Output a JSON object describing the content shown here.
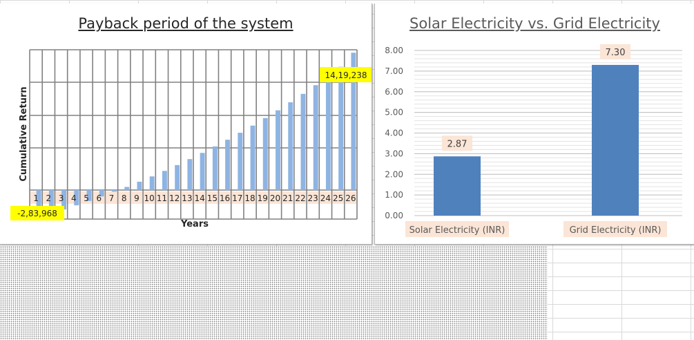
{
  "chart_data": [
    {
      "type": "bar",
      "title": "Payback period of the system",
      "xlabel": "Years",
      "ylabel": "Cumulative Return",
      "categories": [
        "1",
        "2",
        "3",
        "4",
        "5",
        "6",
        "7",
        "8",
        "9",
        "10",
        "11",
        "12",
        "13",
        "14",
        "15",
        "16",
        "17",
        "18",
        "19",
        "20",
        "21",
        "22",
        "23",
        "24",
        "25",
        "26"
      ],
      "values": [
        -283968,
        -243000,
        -201000,
        -158000,
        -113000,
        -66000,
        -17000,
        32000,
        86000,
        141000,
        198000,
        258000,
        320000,
        384000,
        451000,
        520000,
        592000,
        666000,
        744000,
        824000,
        907000,
        994000,
        1084000,
        1177000,
        1274000,
        1419238
      ],
      "ylim": [
        -300000,
        1450000
      ],
      "data_labels": {
        "first": "-2,83,968",
        "last": "14,19,238"
      },
      "bar_color": "#8eb4e3",
      "label_highlight": "#ffff00",
      "tick_label_bg": "#fbe5d6",
      "grid": true
    },
    {
      "type": "bar",
      "title": "Solar Electricity vs. Grid Electricity",
      "categories": [
        "Solar Electricity (INR)",
        "Grid Electricity (INR)"
      ],
      "values": [
        2.87,
        7.3
      ],
      "value_labels": [
        "2.87",
        "7.30"
      ],
      "ylim": [
        0,
        8
      ],
      "yticks": [
        "0.00",
        "1.00",
        "2.00",
        "3.00",
        "4.00",
        "5.00",
        "6.00",
        "7.00",
        "8.00"
      ],
      "bar_color": "#4f81bd",
      "label_bg": "#fbe5d6",
      "grid": true
    }
  ]
}
